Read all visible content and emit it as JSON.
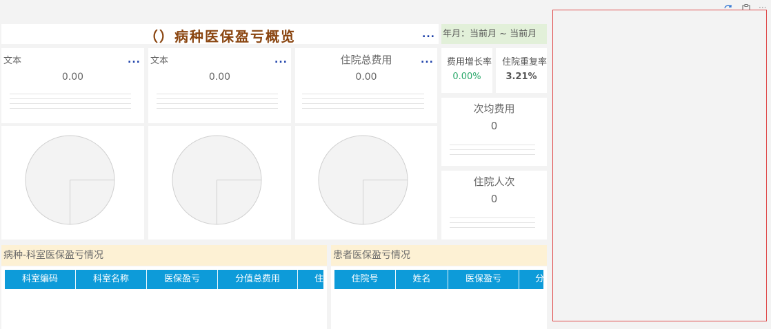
{
  "title": "（）病种医保盈亏概览",
  "date_range": "年月：当前月 ~ 当前月",
  "more_label": "...",
  "cards": [
    {
      "label": "文本",
      "value": "0.00"
    },
    {
      "label": "文本",
      "value": "0.00"
    },
    {
      "label": "住院总费用",
      "value": "0.00"
    }
  ],
  "small_boxes": [
    {
      "label": "费用增长率",
      "value": "0.00%",
      "color": "#2aa86a"
    },
    {
      "label": "住院重复率",
      "value": "3.21%",
      "color": "#555555"
    }
  ],
  "side_metrics": [
    {
      "label": "次均费用",
      "value": "0"
    },
    {
      "label": "住院人次",
      "value": "0"
    }
  ],
  "sections": {
    "dept": {
      "title": "病种-科室医保盈亏情况",
      "columns": [
        "科室编码",
        "科室名称",
        "医保盈亏",
        "分值总费用",
        "住"
      ]
    },
    "patient": {
      "title": "患者医保盈亏情况",
      "columns": [
        "住院号",
        "姓名",
        "医保盈亏",
        "分"
      ]
    }
  },
  "toolbar": {
    "refresh_icon": "refresh-icon",
    "clipboard_icon": "clipboard-icon",
    "more": "···"
  },
  "colors": {
    "title": "#8a4510",
    "header_blue": "#0d9bd9",
    "section_bg": "#fdf1d4",
    "date_bg": "#e2f0d9",
    "panel_border": "#e04a4a"
  }
}
